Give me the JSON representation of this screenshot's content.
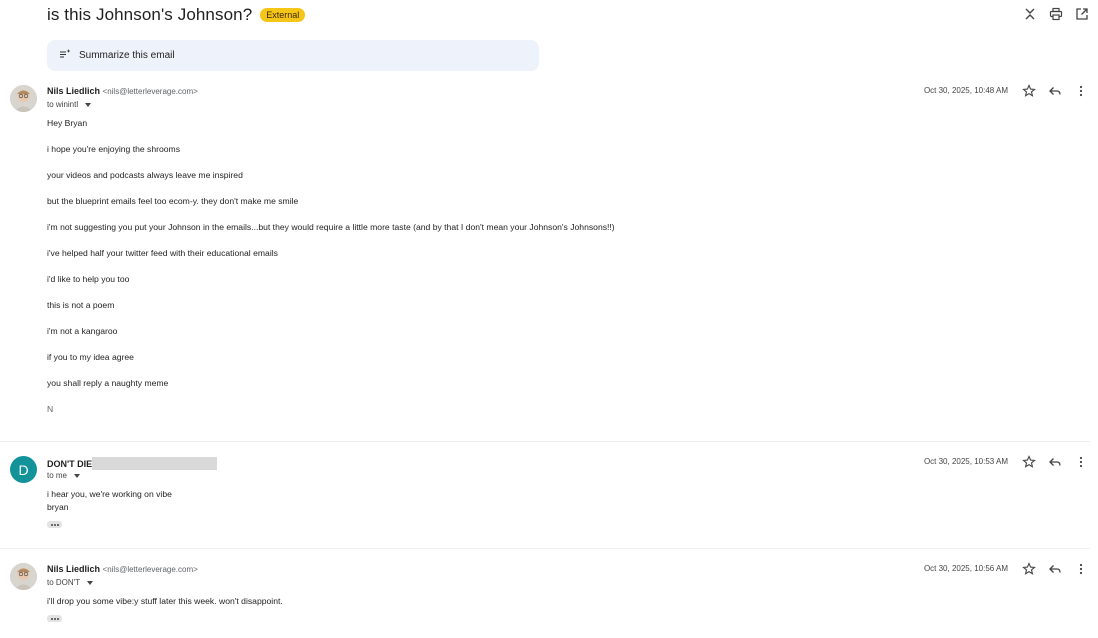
{
  "subject": "is this Johnson's Johnson?",
  "badge": "External",
  "summarize_label": "Summarize this email",
  "icons": [
    "collapse-icon",
    "print-icon",
    "open-new-window-icon",
    "summarize-icon",
    "star-icon",
    "reply-icon",
    "more-vert-icon"
  ],
  "messages": [
    {
      "sender": "Nils Liedlich",
      "email": "<nils@letterleverage.com>",
      "to": "to winintl",
      "date": "Oct 30, 2025, 10:48 AM",
      "lines": [
        "Hey Bryan",
        "i hope you're enjoying the shrooms",
        "your videos and podcasts always leave me inspired",
        "but the blueprint emails feel too ecom-y. they don't make me smile",
        "i'm not suggesting you put your Johnson in the emails...but they would require a little more taste (and by that I don't mean your Johnson's Johnsons!!)",
        "i've helped half your twitter feed with their educational emails",
        "i'd like to help you too",
        "this is not a poem",
        "i'm not a kangaroo",
        "if you to my idea agree",
        "you shall reply a naughty meme"
      ],
      "signature": "N"
    },
    {
      "avatar_letter": "D",
      "sender": "DON'T DIE",
      "to": "to me",
      "date": "Oct 30, 2025, 10:53 AM",
      "lines": [
        "i hear you, we're working on vibe",
        "bryan"
      ]
    },
    {
      "sender": "Nils Liedlich",
      "email": "<nils@letterleverage.com>",
      "to": "to DON'T",
      "date": "Oct 30, 2025, 10:56 AM",
      "lines": [
        "i'll drop you some vibe:y stuff later this week. won't disappoint."
      ]
    }
  ],
  "colors": {
    "badge": "#f5c518",
    "summarize_bg": "#eef2fa",
    "avatar_d": "#12939a"
  }
}
